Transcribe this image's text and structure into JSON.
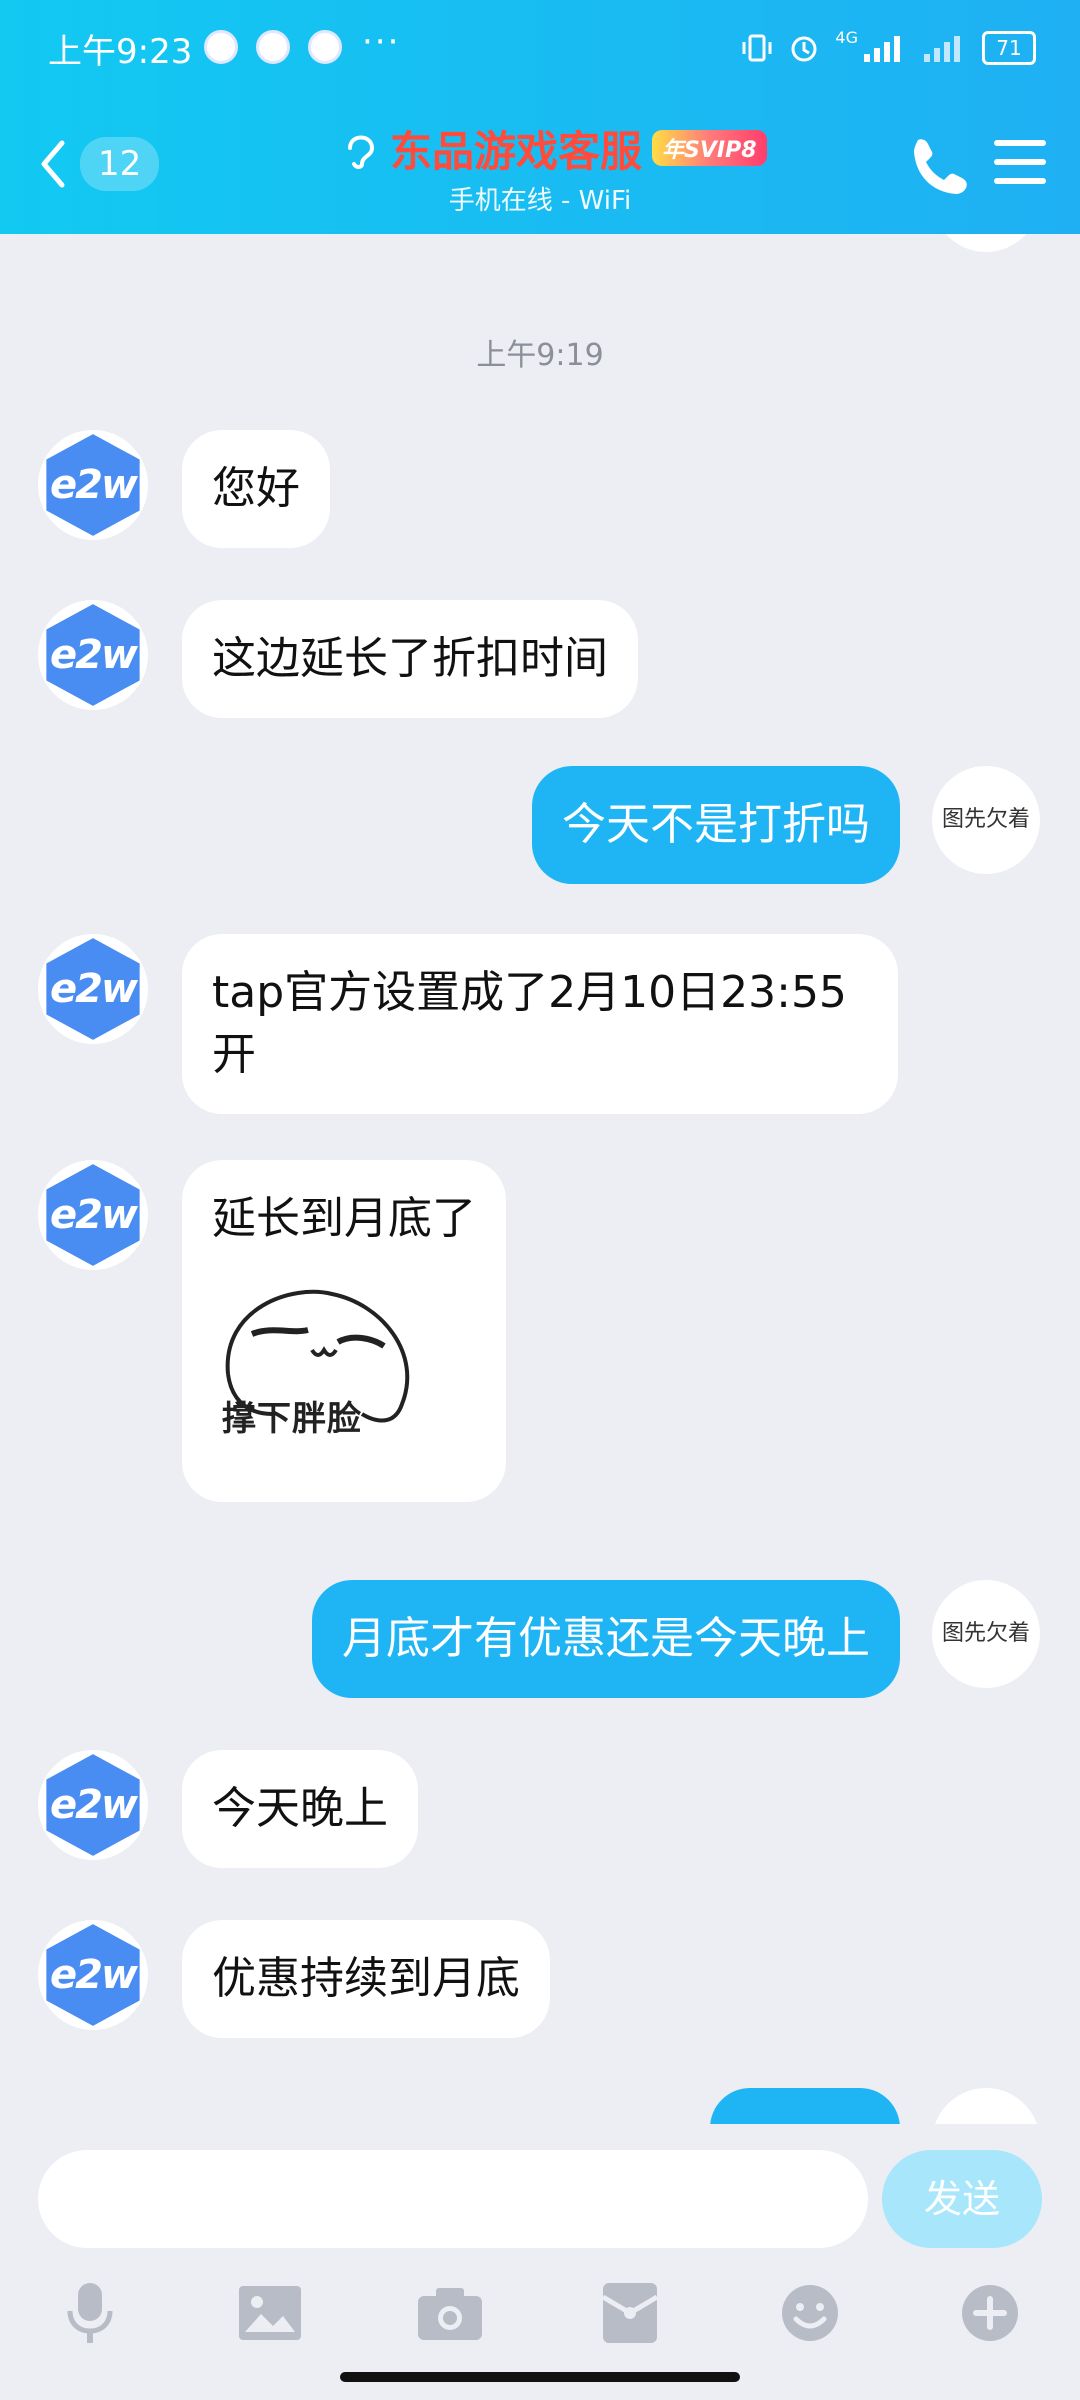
{
  "status": {
    "time": "上午9:23",
    "more": "···",
    "battery": "71",
    "network": "4G"
  },
  "nav": {
    "unread_count": "12",
    "title": "东品游戏客服",
    "badge": "年SVIP8",
    "subtitle": "手机在线 - WiFi"
  },
  "chat": {
    "timestamp": "上午9:19",
    "right_avatar_label": "图先欠着",
    "left_avatar_label": "e2w",
    "messages": [
      {
        "side": "left",
        "text": "您好"
      },
      {
        "side": "left",
        "text": "这边延长了折扣时间"
      },
      {
        "side": "right",
        "text": "今天不是打折吗"
      },
      {
        "side": "left",
        "text": "tap官方设置成了2月10日23:55开"
      },
      {
        "side": "left",
        "text": "延长到月底了",
        "sticker_caption": "撑下胖脸"
      },
      {
        "side": "right",
        "text": "月底才有优惠还是今天晚上"
      },
      {
        "side": "left",
        "text": "今天晚上"
      },
      {
        "side": "left",
        "text": "优惠持续到月底"
      }
    ]
  },
  "input": {
    "placeholder": "",
    "send_label": "发送"
  },
  "tools": [
    "microphone-icon",
    "image-icon",
    "camera-icon",
    "red-packet-icon",
    "emoji-icon",
    "plus-icon"
  ],
  "colors": {
    "header": "#1fb0f3",
    "bubble_me": "#1fb5f5",
    "bubble_other": "#ffffff",
    "title": "#ff4b3b",
    "avatar": "#4a8df2"
  }
}
